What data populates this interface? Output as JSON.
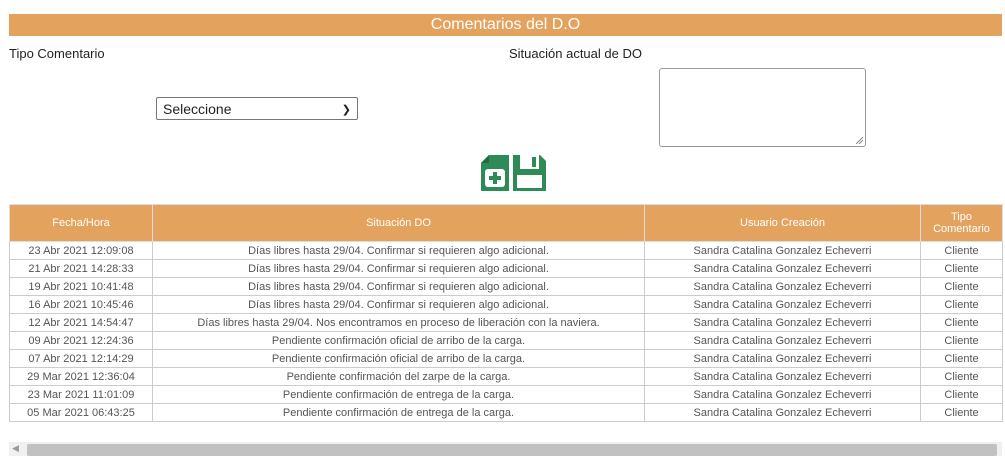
{
  "header": {
    "title": "Comentarios del D.O"
  },
  "form": {
    "tipo_label": "Tipo Comentario",
    "situacion_label": "Situación actual de DO",
    "select_value": "Seleccione",
    "textarea_value": ""
  },
  "icons": {
    "add": "add-document-icon",
    "save": "save-icon"
  },
  "colors": {
    "accent": "#e3a35f"
  },
  "table": {
    "headers": [
      "Fecha/Hora",
      "Situación DO",
      "Usuario Creación",
      "Tipo Comentario"
    ],
    "rows": [
      [
        "23 Abr 2021 12:09:08",
        "Días libres hasta 29/04. Confirmar si requieren algo adicional.",
        "Sandra Catalina Gonzalez Echeverri",
        "Cliente"
      ],
      [
        "21 Abr 2021 14:28:33",
        "Días libres hasta 29/04. Confirmar si requieren algo adicional.",
        "Sandra Catalina Gonzalez Echeverri",
        "Cliente"
      ],
      [
        "19 Abr 2021 10:41:48",
        "Días libres hasta 29/04. Confirmar si requieren algo adicional.",
        "Sandra Catalina Gonzalez Echeverri",
        "Cliente"
      ],
      [
        "16 Abr 2021 10:45:46",
        "Días libres hasta 29/04. Confirmar si requieren algo adicional.",
        "Sandra Catalina Gonzalez Echeverri",
        "Cliente"
      ],
      [
        "12 Abr 2021 14:54:47",
        "Días libres hasta 29/04. Nos encontramos en proceso de liberación con la naviera.",
        "Sandra Catalina Gonzalez Echeverri",
        "Cliente"
      ],
      [
        "09 Abr 2021 12:24:36",
        "Pendiente confirmación oficial de arribo de la carga.",
        "Sandra Catalina Gonzalez Echeverri",
        "Cliente"
      ],
      [
        "07 Abr 2021 12:14:29",
        "Pendiente confirmación oficial de arribo de la carga.",
        "Sandra Catalina Gonzalez Echeverri",
        "Cliente"
      ],
      [
        "29 Mar 2021 12:36:04",
        "Pendiente confirmación del zarpe de la carga.",
        "Sandra Catalina Gonzalez Echeverri",
        "Cliente"
      ],
      [
        "23 Mar 2021 11:01:09",
        "Pendiente confirmación de entrega de la carga.",
        "Sandra Catalina Gonzalez Echeverri",
        "Cliente"
      ],
      [
        "05 Mar 2021 06:43:25",
        "Pendiente confirmación de entrega de la carga.",
        "Sandra Catalina Gonzalez Echeverri",
        "Cliente"
      ]
    ]
  }
}
